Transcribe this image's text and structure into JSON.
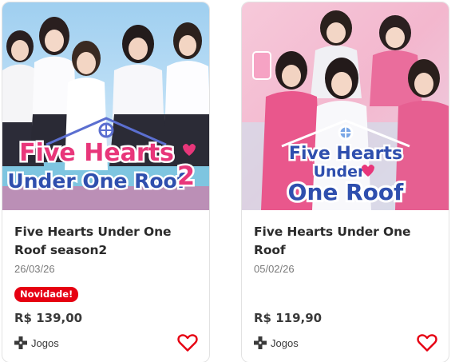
{
  "products": [
    {
      "title": "Five Hearts Under One Roof season2",
      "date": "26/03/26",
      "badge": "Novidade!",
      "price": "R$ 139,00",
      "platform": "Jogos",
      "cover_text": [
        "Five Hearts",
        "Under One Roof",
        "2"
      ]
    },
    {
      "title": "Five Hearts Under One Roof",
      "date": "05/02/26",
      "badge": "",
      "price": "R$ 119,90",
      "platform": "Jogos",
      "cover_text": [
        "Five Hearts",
        "Under",
        "One Roof"
      ]
    }
  ],
  "colors": {
    "badge": "#e60012",
    "heart": "#e60012",
    "cover1_sky": "#8fc6ec",
    "cover2_bg": "#f4c3d6",
    "logo_pink": "#e8367a",
    "logo_blue": "#2f4fae"
  },
  "icons": {
    "favorite": "heart-outline-icon",
    "platform": "dpad-icon",
    "house": "house-icon"
  }
}
